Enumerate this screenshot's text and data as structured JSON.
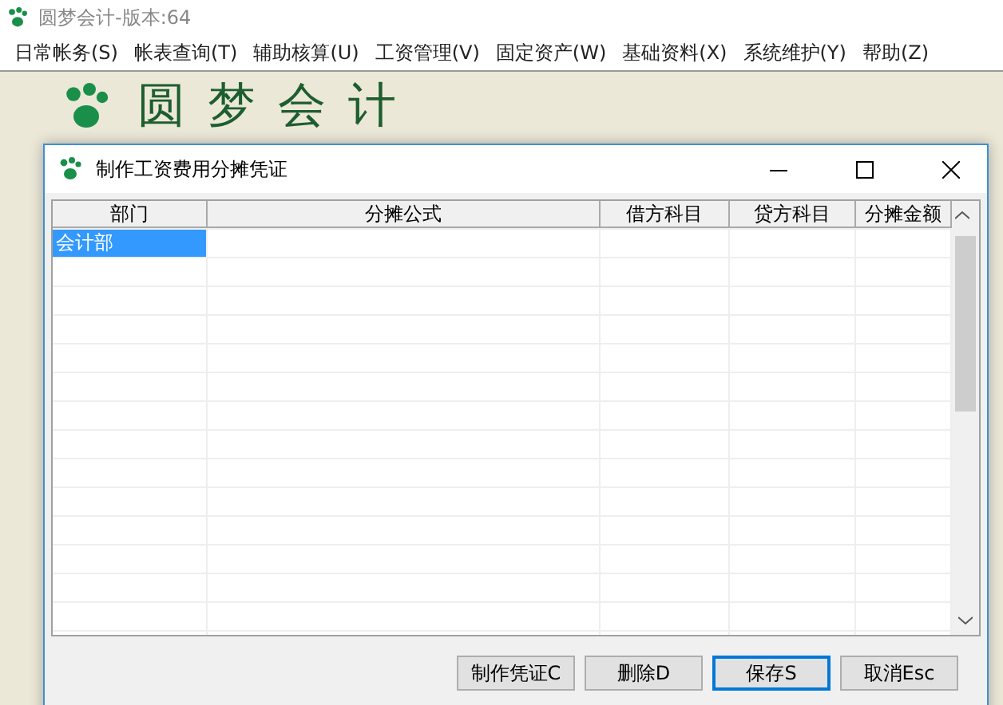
{
  "app": {
    "title": "圆梦会计-版本:64",
    "logo_text": "圆梦会计",
    "menu": [
      "日常帐务(S)",
      "帐表查询(T)",
      "辅助核算(U)",
      "工资管理(V)",
      "固定资产(W)",
      "基础资料(X)",
      "系统维护(Y)",
      "帮助(Z)"
    ]
  },
  "dialog": {
    "title": "制作工资费用分摊凭证",
    "columns": [
      "部门",
      "分摊公式",
      "借方科目",
      "贷方科目",
      "分摊金额"
    ],
    "rows": [
      {
        "cells": [
          "会计部",
          "",
          "",
          "",
          ""
        ],
        "selected": true
      }
    ],
    "buttons": [
      {
        "label": "制作凭证C",
        "default": false
      },
      {
        "label": "删除D",
        "default": false
      },
      {
        "label": "保存S",
        "default": true
      },
      {
        "label": "取消Esc",
        "default": false
      }
    ]
  }
}
